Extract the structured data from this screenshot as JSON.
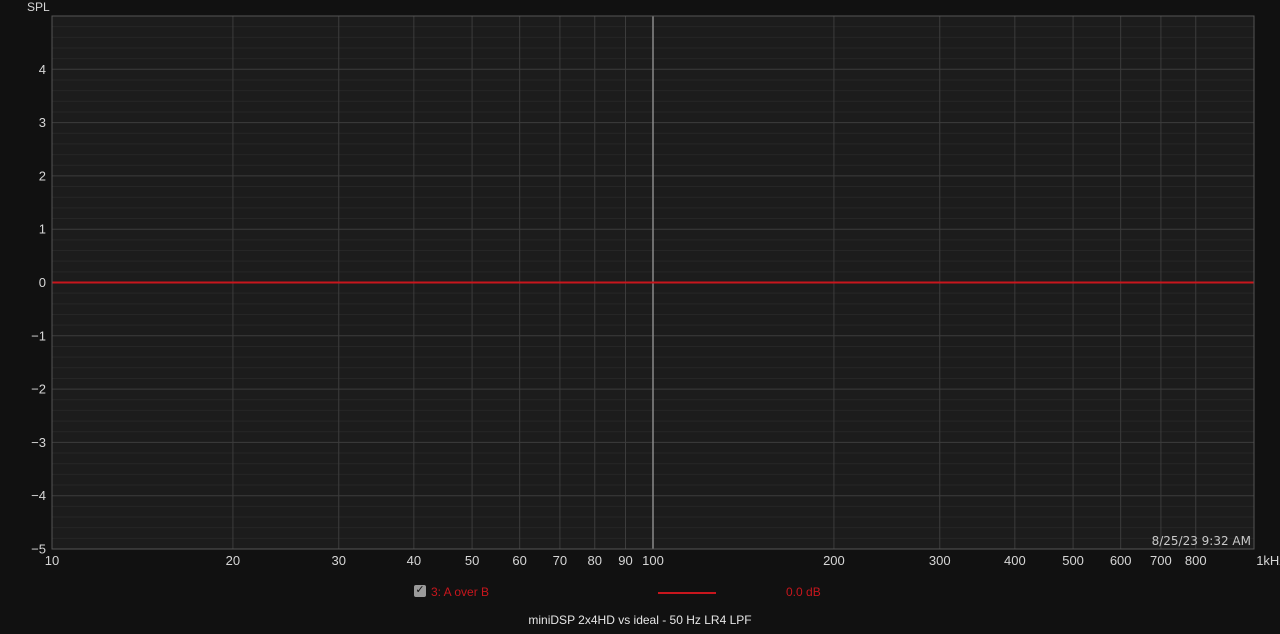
{
  "chart_data": {
    "type": "line",
    "x_scale": "log",
    "xlim": [
      10,
      1000
    ],
    "ylim": [
      -5,
      5
    ],
    "y_axis_label": "SPL",
    "x_ticks": [
      10,
      20,
      30,
      40,
      50,
      60,
      70,
      80,
      90,
      100,
      200,
      300,
      400,
      500,
      600,
      700,
      800,
      1000
    ],
    "x_tick_labels": [
      "10",
      "20",
      "30",
      "40",
      "50",
      "60",
      "70",
      "80",
      "90",
      "100",
      "200",
      "300",
      "400",
      "500",
      "600",
      "700",
      "800",
      "1kHz"
    ],
    "y_ticks": [
      4,
      3,
      2,
      1,
      0,
      -1,
      -2,
      -3,
      -4,
      -5
    ],
    "y_tick_labels": [
      "4",
      "3",
      "2",
      "1",
      "0",
      "−1",
      "−2",
      "−3",
      "−4",
      "−5"
    ],
    "grid": true,
    "series": [
      {
        "name": "3: A over B",
        "color": "#c8161d",
        "x": [
          10,
          20,
          50,
          100,
          200,
          500,
          1000
        ],
        "y": [
          0,
          0,
          0,
          0,
          0,
          0,
          0
        ]
      }
    ],
    "timestamp": "8/25/23 9:32 AM",
    "caption": "miniDSP 2x4HD vs ideal - 50 Hz LR4 LPF"
  },
  "legend": {
    "checked": true,
    "check_glyph": "✓",
    "name": "3: A over B",
    "value": "0.0 dB",
    "color": "#c8161d"
  },
  "colors": {
    "background": "#111111",
    "plot_background": "#1c1c1c",
    "grid_major": "#3c3c3c",
    "grid_minor": "#262626",
    "highlight_grid": "#8a8a8a"
  }
}
